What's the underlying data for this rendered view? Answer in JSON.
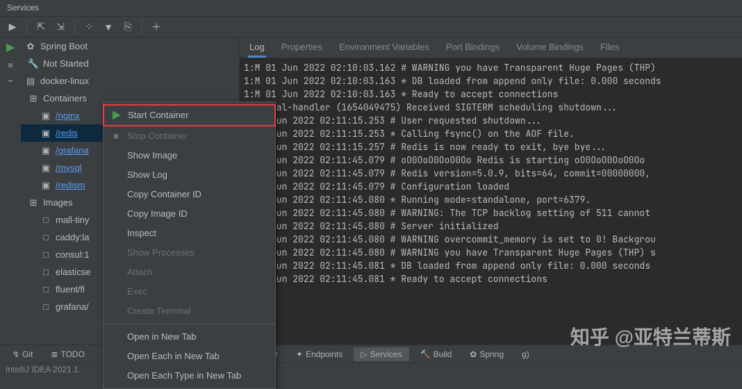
{
  "title": "Services",
  "tree": {
    "root1": "Spring Boot",
    "root1sub": "Not Started",
    "root2": "docker-linux",
    "containers": "Containers",
    "items": [
      "/nginx",
      "/redis",
      "/grafana",
      "/mysql",
      "/redism"
    ],
    "images_label": "Images",
    "images": [
      "mall-tiny",
      "caddy:la",
      "consul:1",
      "elasticse",
      "fluent/fl",
      "grafana/"
    ]
  },
  "context_menu": {
    "start": "Start Container",
    "stop": "Stop Container",
    "showimg": "Show Image",
    "showlog": "Show Log",
    "copycid": "Copy Container ID",
    "copyiid": "Copy Image ID",
    "inspect": "Inspect",
    "showproc": "Show Processes",
    "attach": "Attach",
    "exec": "Exec",
    "createterm": "Create Terminal",
    "openintab": "Open in New Tab",
    "openeach": "Open Each in New Tab",
    "openeachtype": "Open Each Type in New Tab"
  },
  "tabs": {
    "log": "Log",
    "properties": "Properties",
    "env": "Environment Variables",
    "portbindings": "Port Bindings",
    "volbindings": "Volume Bindings",
    "files": "Files"
  },
  "logs": [
    "1:M 01 Jun 2022 02:10:03.162 # WARNING you have Transparent Huge Pages (THP)",
    "1:M 01 Jun 2022 02:10:03.163 * DB loaded from append only file: 0.000 seconds",
    "1:M 01 Jun 2022 02:10:03.163 * Ready to accept connections",
    "1:signal-handler (1654049475) Received SIGTERM scheduling shutdown...",
    "1 01 Jun 2022 02:11:15.253 # User requested shutdown...",
    "1 01 Jun 2022 02:11:15.253 * Calling fsync() on the AOF file.",
    "1 01 Jun 2022 02:11:15.257 # Redis is now ready to exit, bye bye...",
    "C 01 Jun 2022 02:11:45.079 # oO0OoO0OoO0Oo Redis is starting oO0OoO0OoO0Oo",
    "C 01 Jun 2022 02:11:45.079 # Redis version=5.0.9, bits=64, commit=00000000,",
    "C 01 Jun 2022 02:11:45.079 # Configuration loaded",
    "1 01 Jun 2022 02:11:45.080 * Running mode=standalone, port=6379.",
    "1 01 Jun 2022 02:11:45.080 # WARNING: The TCP backlog setting of 511 cannot",
    "1 01 Jun 2022 02:11:45.080 # Server initialized",
    "1 01 Jun 2022 02:11:45.080 # WARNING overcommit_memory is set to 0! Backgrou",
    "1 01 Jun 2022 02:11:45.080 # WARNING you have Transparent Huge Pages (THP) s",
    "1 01 Jun 2022 02:11:45.081 * DB loaded from append only file: 0.000 seconds",
    "1 01 Jun 2022 02:11:45.081 * Ready to accept connections"
  ],
  "bottom_tabs": {
    "git": "Git",
    "todo": "TODO",
    "profiler": "iler",
    "endpoints": "Endpoints",
    "services": "Services",
    "build": "Build",
    "spring": "Spring",
    "log_ext": "g)"
  },
  "status": "IntelliJ IDEA 2021.1.",
  "watermark": "知乎 @亚特兰蒂斯"
}
